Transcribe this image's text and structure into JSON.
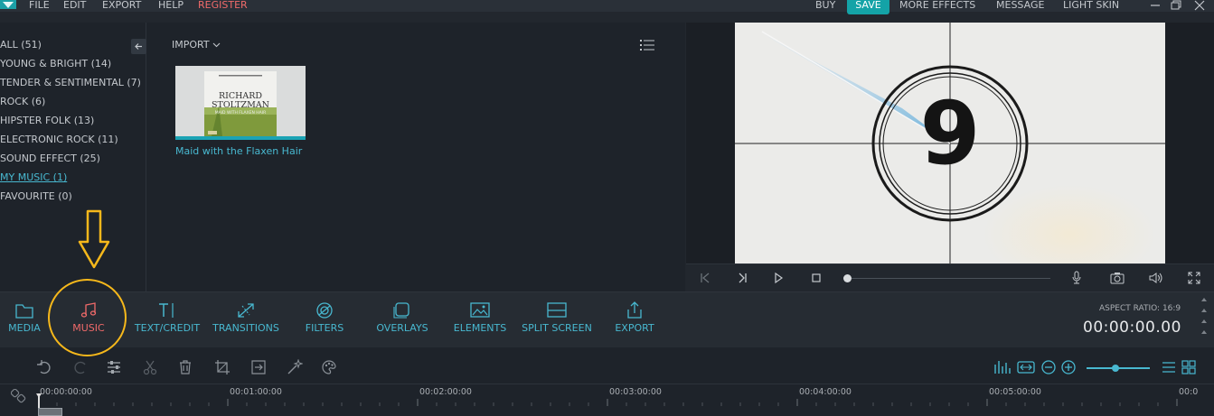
{
  "menubar": {
    "items": [
      "FILE",
      "EDIT",
      "EXPORT",
      "HELP",
      "REGISTER"
    ],
    "right_items": [
      "BUY",
      "SAVE",
      "MORE EFFECTS",
      "MESSAGE",
      "LIGHT SKIN"
    ]
  },
  "library": {
    "categories": [
      {
        "label": "ALL (51)"
      },
      {
        "label": "YOUNG & BRIGHT (14)"
      },
      {
        "label": "TENDER & SENTIMENTAL (7)"
      },
      {
        "label": "ROCK (6)"
      },
      {
        "label": "HIPSTER FOLK (13)"
      },
      {
        "label": "ELECTRONIC ROCK (11)"
      },
      {
        "label": "SOUND EFFECT (25)"
      },
      {
        "label": "MY MUSIC (1)"
      },
      {
        "label": "FAVOURITE (0)"
      }
    ],
    "active_category": "MY MUSIC (1)",
    "import_label": "IMPORT",
    "item": {
      "title": "Maid with the Flaxen Hair",
      "cover_artist": "RICHARD STOLTZMAN",
      "cover_subtitle": "MAID WITH FLAXEN HAIR"
    }
  },
  "preview": {
    "countdown_number": "9"
  },
  "tools": [
    {
      "label": "MEDIA",
      "icon": "folder-icon"
    },
    {
      "label": "MUSIC",
      "icon": "music-note-icon"
    },
    {
      "label": "TEXT/CREDIT",
      "icon": "text-cursor-icon"
    },
    {
      "label": "TRANSITIONS",
      "icon": "transitions-icon"
    },
    {
      "label": "FILTERS",
      "icon": "filters-icon"
    },
    {
      "label": "OVERLAYS",
      "icon": "overlays-icon"
    },
    {
      "label": "ELEMENTS",
      "icon": "image-icon"
    },
    {
      "label": "SPLIT SCREEN",
      "icon": "split-screen-icon"
    },
    {
      "label": "EXPORT",
      "icon": "upload-icon"
    }
  ],
  "active_tool": "MUSIC",
  "aspect_ratio": "ASPECT RATIO: 16:9",
  "timecode": "00:00:00.00",
  "timeline": {
    "ticks": [
      "00:00:00:00",
      "00:01:00:00",
      "00:02:00:00",
      "00:03:00:00",
      "00:04:00:00",
      "00:05:00:00",
      "00:0"
    ]
  },
  "colors": {
    "accent": "#48b8d0",
    "active": "#f06a6a",
    "save_bg": "#14a3a7",
    "annotation": "#f6b81b"
  }
}
